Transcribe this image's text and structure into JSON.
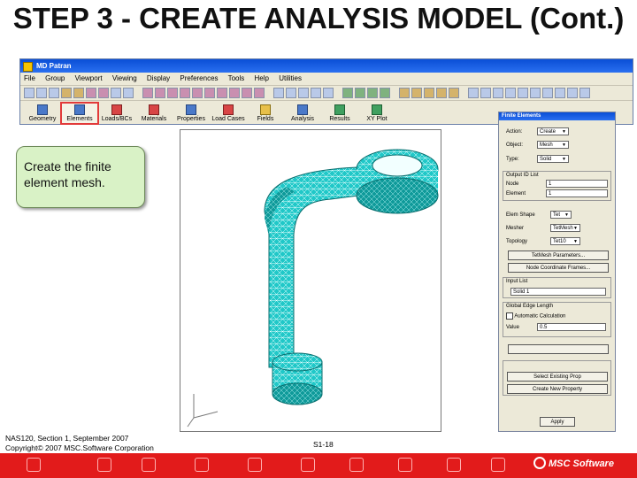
{
  "slide": {
    "title": "STEP 3 - CREATE ANALYSIS MODEL (Cont.)"
  },
  "app": {
    "window_title": "MD Patran",
    "menu": [
      "File",
      "Group",
      "Viewport",
      "Viewing",
      "Display",
      "Preferences",
      "Tools",
      "Help",
      "Utilities"
    ],
    "tabs": [
      {
        "label": "Geometry",
        "icon": "geometry-icon"
      },
      {
        "label": "Elements",
        "icon": "elements-icon",
        "active": true
      },
      {
        "label": "Loads/BCs",
        "icon": "loads-icon"
      },
      {
        "label": "Materials",
        "icon": "materials-icon"
      },
      {
        "label": "Properties",
        "icon": "properties-icon"
      },
      {
        "label": "Load Cases",
        "icon": "loadcases-icon"
      },
      {
        "label": "Fields",
        "icon": "fields-icon"
      },
      {
        "label": "Analysis",
        "icon": "analysis-icon"
      },
      {
        "label": "Results",
        "icon": "results-icon"
      },
      {
        "label": "XY Plot",
        "icon": "xyplot-icon"
      }
    ]
  },
  "callout": {
    "text": "Create the finite element mesh."
  },
  "panel": {
    "title": "Finite Elements",
    "action_label": "Action:",
    "action_value": "Create",
    "object_label": "Object:",
    "object_value": "Mesh",
    "type_label": "Type:",
    "type_value": "Solid",
    "output_ids_label": "Output ID List",
    "node_label": "Node",
    "node_value": "1",
    "element_label": "Element",
    "element_value": "1",
    "elem_shape_label": "Elem Shape",
    "elem_shape_value": "Tet",
    "mesher_label": "Mesher",
    "mesher_value": "TetMesh",
    "topology_label": "Topology",
    "topology_value": "Tet10",
    "btn_tetmesh": "TetMesh Parameters...",
    "btn_node_coords": "Node Coordinate Frames...",
    "input_list_label": "Input List",
    "input_list_value": "Solid 1",
    "global_edge_label": "Global Edge Length",
    "auto_calc_label": "Automatic Calculation",
    "value_label": "Value",
    "value_value": "0.5",
    "btn_property": "Select Existing Prop",
    "btn_create_prop": "Create New Property",
    "btn_apply": "Apply"
  },
  "footer": {
    "line1": "NAS120, Section 1, September 2007",
    "line2": "Copyright© 2007 MSC.Software Corporation",
    "page": "S1-18",
    "brand": "MSC Software"
  },
  "colors": {
    "slide_bottom_bar": "#e21b1b",
    "mesh_fill": "#20c8c8",
    "callout_fill": "#d9f2c6",
    "active_tab_outline": "#e23a3a"
  }
}
